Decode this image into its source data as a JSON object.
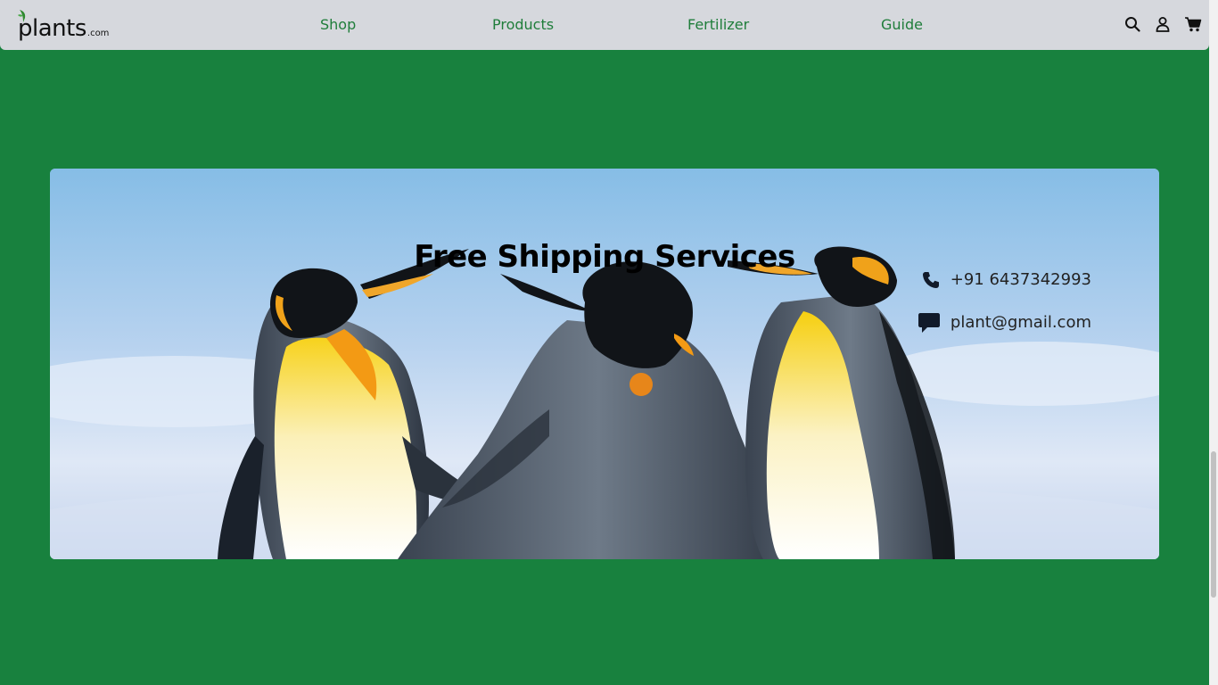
{
  "brand": {
    "name": "plants",
    "suffix": ".com"
  },
  "nav": {
    "links": [
      {
        "label": "Shop"
      },
      {
        "label": "Products"
      },
      {
        "label": "Fertilizer"
      },
      {
        "label": "Guide"
      }
    ],
    "icons": [
      "search-icon",
      "user-icon",
      "cart-icon"
    ]
  },
  "hero": {
    "title": "Free Shipping Services",
    "phone": "+91 6437342993",
    "email": "plant@gmail.com",
    "image": "penguins"
  },
  "colors": {
    "page_bg": "#18813e",
    "navbar_bg": "#d6d8dd",
    "nav_link": "#1f7d3a"
  }
}
